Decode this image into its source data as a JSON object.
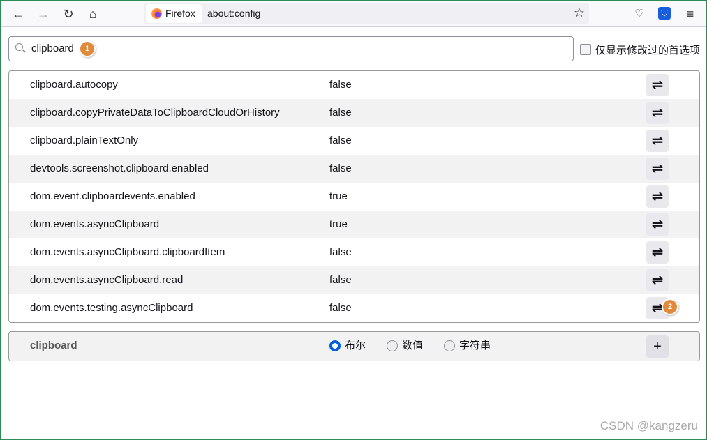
{
  "toolbar": {
    "identity": "Firefox",
    "url": "about:config"
  },
  "search": {
    "value": "clipboard",
    "badge": "1"
  },
  "modified_only_label": "仅显示修改过的首选项",
  "prefs": [
    {
      "name": "clipboard.autocopy",
      "value": "false"
    },
    {
      "name": "clipboard.copyPrivateDataToClipboardCloudOrHistory",
      "value": "false"
    },
    {
      "name": "clipboard.plainTextOnly",
      "value": "false"
    },
    {
      "name": "devtools.screenshot.clipboard.enabled",
      "value": "false"
    },
    {
      "name": "dom.event.clipboardevents.enabled",
      "value": "true"
    },
    {
      "name": "dom.events.asyncClipboard",
      "value": "true"
    },
    {
      "name": "dom.events.asyncClipboard.clipboardItem",
      "value": "false"
    },
    {
      "name": "dom.events.asyncClipboard.read",
      "value": "false"
    },
    {
      "name": "dom.events.testing.asyncClipboard",
      "value": "false"
    }
  ],
  "toggle_badge": "2",
  "add_row": {
    "name": "clipboard",
    "types": [
      "布尔",
      "数值",
      "字符串"
    ],
    "selected": "布尔",
    "add_label": "+"
  },
  "watermark": "CSDN @kangzeru"
}
